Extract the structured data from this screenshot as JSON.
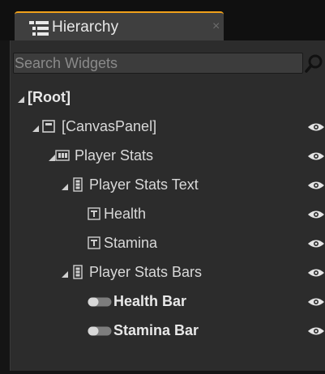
{
  "tab": {
    "title": "Hierarchy",
    "close": "×"
  },
  "search": {
    "placeholder": "Search Widgets"
  },
  "tree": [
    {
      "label": "[Root]",
      "depth": 0,
      "icon": "none",
      "expand": true,
      "bold": true,
      "eye": false
    },
    {
      "label": "[CanvasPanel]",
      "depth": 1,
      "icon": "canvas-panel-icon",
      "expand": true,
      "bold": false,
      "eye": true
    },
    {
      "label": "Player Stats",
      "depth": 2,
      "icon": "horizontal-box-icon",
      "expand": true,
      "bold": false,
      "eye": true
    },
    {
      "label": "Player Stats Text",
      "depth": 3,
      "icon": "vertical-box-icon",
      "expand": true,
      "bold": false,
      "eye": true
    },
    {
      "label": "Health",
      "depth": 4,
      "icon": "text-block-icon",
      "expand": false,
      "bold": false,
      "eye": true
    },
    {
      "label": "Stamina",
      "depth": 4,
      "icon": "text-block-icon",
      "expand": false,
      "bold": false,
      "eye": true
    },
    {
      "label": "Player Stats Bars",
      "depth": 3,
      "icon": "vertical-box-icon",
      "expand": true,
      "bold": false,
      "eye": true
    },
    {
      "label": "Health Bar",
      "depth": 4,
      "icon": "progress-bar-icon",
      "expand": false,
      "bold": true,
      "eye": true
    },
    {
      "label": "Stamina Bar",
      "depth": 4,
      "icon": "progress-bar-icon",
      "expand": false,
      "bold": true,
      "eye": true
    }
  ],
  "colors": {
    "tab_accent": "#f0a01a",
    "panel_bg": "#2c2c2c",
    "text": "#d9d9d9"
  }
}
